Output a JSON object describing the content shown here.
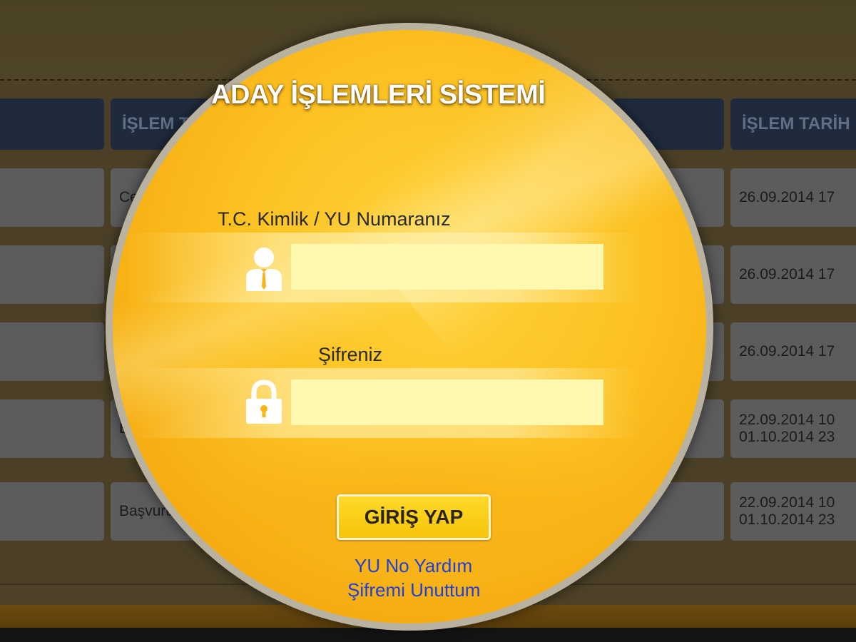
{
  "background_table": {
    "headers": [
      "",
      "İŞLEM T",
      "",
      "İŞLEM TARİH"
    ],
    "rows": [
      {
        "col2": "Ce",
        "date_line1": "26.09.2014 17",
        "date_line2": ""
      },
      {
        "col2": "",
        "date_line1": "26.09.2014 17",
        "date_line2": ""
      },
      {
        "col2": "",
        "date_line1": "26.09.2014 17",
        "date_line2": ""
      },
      {
        "col2": "Bı",
        "date_line1": "22.09.2014 10",
        "date_line2": "01.10.2014 23"
      },
      {
        "col2": "Başvuru",
        "date_line1": "22.09.2014 10",
        "date_line2": "01.10.2014 23"
      }
    ]
  },
  "login": {
    "title": "ADAY İŞLEMLERİ SİSTEMİ",
    "id_label": "T.C. Kimlik / YU Numaranız",
    "id_value": "",
    "password_label": "Şifreniz",
    "password_value": "",
    "submit_label": "GİRİŞ YAP",
    "help_link": "YU No Yardım",
    "forgot_link": "Şifremi Unuttum",
    "user_icon": "user-icon",
    "lock_icon": "lock-icon"
  },
  "colors": {
    "circle_gold": "#fcc020",
    "input_bg": "#fff9b0",
    "link_blue": "#1f3fd8",
    "header_navy": "#1f2b3d"
  }
}
